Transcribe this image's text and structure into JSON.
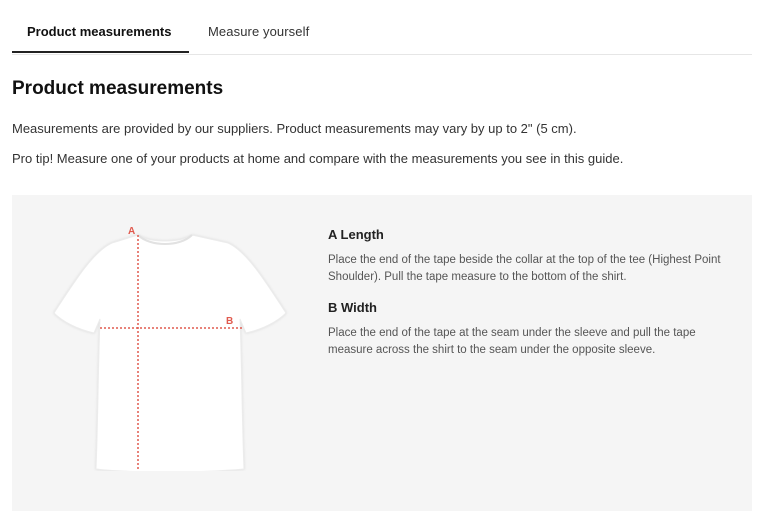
{
  "tabs": [
    {
      "label": "Product measurements",
      "active": true
    },
    {
      "label": "Measure yourself",
      "active": false
    }
  ],
  "page_title": "Product measurements",
  "paragraphs": [
    "Measurements are provided by our suppliers. Product measurements may vary by up to 2\" (5 cm).",
    "Pro tip! Measure one of your products at home and compare with the measurements you see in this guide."
  ],
  "diagram": {
    "label_a": "A",
    "label_b": "B",
    "measure_color": "#e05a4e",
    "shirt_color": "#ffffff"
  },
  "measurements": [
    {
      "heading": "A Length",
      "description": "Place the end of the tape beside the collar at the top of the tee (Highest Point Shoulder). Pull the tape measure to the bottom of the shirt."
    },
    {
      "heading": "B Width",
      "description": "Place the end of the tape at the seam under the sleeve and pull the tape measure across the shirt to the seam under the opposite sleeve."
    }
  ],
  "colors": {
    "panel_background": "#f5f5f5",
    "tab_underline": "#222222"
  }
}
